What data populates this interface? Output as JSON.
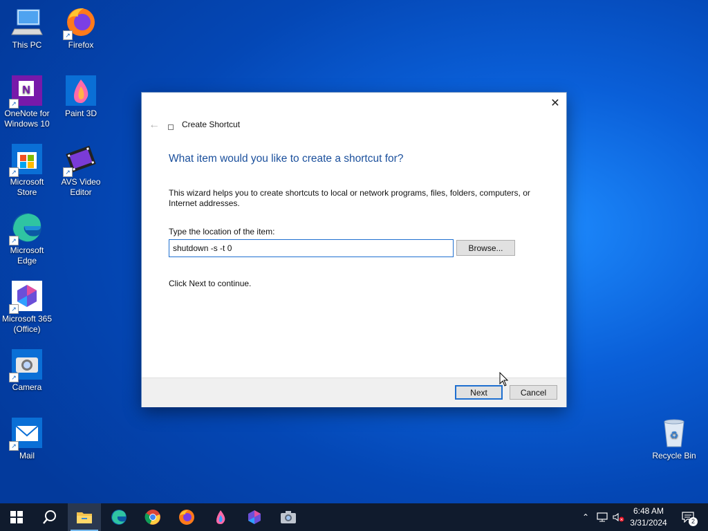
{
  "desktop": {
    "icons": [
      {
        "label": "This PC",
        "icon": "this-pc-icon"
      },
      {
        "label": "Firefox",
        "icon": "firefox-icon"
      },
      {
        "label": "OneNote for Windows 10",
        "icon": "onenote-icon"
      },
      {
        "label": "Paint 3D",
        "icon": "paint3d-icon"
      },
      {
        "label": "Microsoft Store",
        "icon": "store-icon"
      },
      {
        "label": "AVS Video Editor",
        "icon": "avs-icon"
      },
      {
        "label": "Microsoft Edge",
        "icon": "edge-icon"
      },
      {
        "label": "Microsoft 365 (Office)",
        "icon": "m365-icon"
      },
      {
        "label": "Camera",
        "icon": "camera-icon"
      },
      {
        "label": "Mail",
        "icon": "mail-icon"
      },
      {
        "label": "Recycle Bin",
        "icon": "recycle-bin-icon"
      }
    ]
  },
  "dialog": {
    "title": "Create Shortcut",
    "heading": "What item would you like to create a shortcut for?",
    "description": "This wizard helps you to create shortcuts to local or network programs, files, folders, computers, or Internet addresses.",
    "location_label": "Type the location of the item:",
    "location_value": "shutdown -s -t 0",
    "browse_label": "Browse...",
    "hint": "Click Next to continue.",
    "next_label": "Next",
    "cancel_label": "Cancel"
  },
  "taskbar": {
    "apps": [
      "start",
      "search",
      "file-explorer",
      "edge",
      "chrome",
      "firefox",
      "paint3d",
      "m365",
      "camera"
    ],
    "active_app": "file-explorer",
    "time": "6:48 AM",
    "date": "3/31/2024",
    "notification_count": "2"
  },
  "colors": {
    "accent": "#1e6fd0",
    "heading": "#1a4f9c",
    "taskbar": "#101b2d"
  }
}
